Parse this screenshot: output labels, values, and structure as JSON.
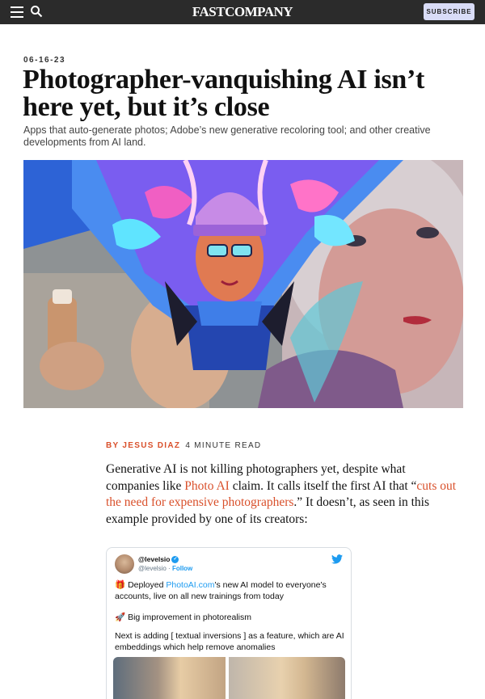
{
  "nav": {
    "logo": "FASTCOMPANY",
    "subscribe_label": "SUBSCRIBE"
  },
  "article": {
    "date": "06-16-23",
    "headline": "Photographer-vanquishing AI isn’t here yet, but it’s close",
    "dek": "Apps that auto-generate photos; Adobe’s new generative recoloring tool; and other creative developments from AI land.",
    "byline_prefix": "BY",
    "author": "JESUS DIAZ",
    "read_time": "4 MINUTE READ",
    "body": {
      "p1_a": "Generative AI is not killing photographers yet, despite what companies like ",
      "link1": "Photo AI",
      "p1_b": " claim. It calls itself the first AI that “",
      "link2": "cuts out the need for expensive photographers",
      "p1_c": ".” It doesn’t, as seen in this example provided by one of its creators:"
    }
  },
  "tweet": {
    "name": "@levelsio",
    "handle": "@levelsio",
    "separator": "·",
    "follow": "Follow",
    "line1_pre": "Deployed ",
    "line1_link": "PhotoAI.com",
    "line1_post": "'s new AI model to everyone's accounts, live on all new trainings from today",
    "line2": "Big improvement in photorealism",
    "line3": "Next is adding [ textual inversions ] as a feature, which are AI embeddings which help remove anomalies",
    "icons": [
      "gift-emoji",
      "rocket-emoji"
    ]
  },
  "colors": {
    "accent": "#d9502b",
    "nav_bg": "#2b2b2b",
    "subscribe_bg": "#d9dcf7",
    "twitter_blue": "#1d9bf0"
  }
}
